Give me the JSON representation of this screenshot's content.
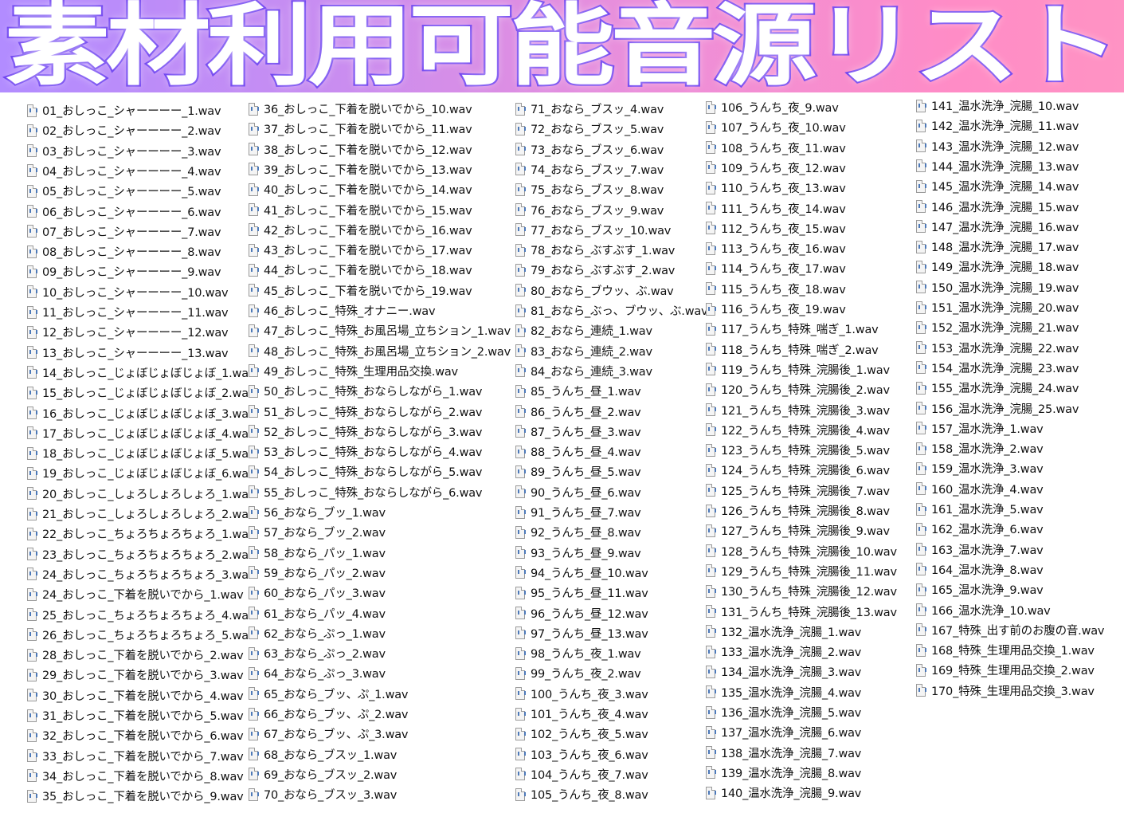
{
  "title": "素材利用可能音源リスト",
  "icon": "wav-file-icon",
  "columns": [
    [
      "01_おしっこ_シャーーーー_1.wav",
      "02_おしっこ_シャーーーー_2.wav",
      "03_おしっこ_シャーーーー_3.wav",
      "04_おしっこ_シャーーーー_4.wav",
      "05_おしっこ_シャーーーー_5.wav",
      "06_おしっこ_シャーーーー_6.wav",
      "07_おしっこ_シャーーーー_7.wav",
      "08_おしっこ_シャーーーー_8.wav",
      "09_おしっこ_シャーーーー_9.wav",
      "10_おしっこ_シャーーーー_10.wav",
      "11_おしっこ_シャーーーー_11.wav",
      "12_おしっこ_シャーーーー_12.wav",
      "13_おしっこ_シャーーーー_13.wav",
      "14_おしっこ_じょぼじょぼじょぼ_1.wav",
      "15_おしっこ_じょぼじょぼじょぼ_2.wav",
      "16_おしっこ_じょぼじょぼじょぼ_3.wav",
      "17_おしっこ_じょぼじょぼじょぼ_4.wav",
      "18_おしっこ_じょぼじょぼじょぼ_5.wav",
      "19_おしっこ_じょぼじょぼじょぼ_6.wav",
      "20_おしっこ_しょろしょろしょろ_1.wav",
      "21_おしっこ_しょろしょろしょろ_2.wav",
      "22_おしっこ_ちょろちょろちょろ_1.wav",
      "23_おしっこ_ちょろちょろちょろ_2.wav",
      "24_おしっこ_ちょろちょろちょろ_3.wav",
      "24_おしっこ_下着を脱いでから_1.wav",
      "25_おしっこ_ちょろちょろちょろ_4.wav",
      "26_おしっこ_ちょろちょろちょろ_5.wav",
      "28_おしっこ_下着を脱いでから_2.wav",
      "29_おしっこ_下着を脱いでから_3.wav",
      "30_おしっこ_下着を脱いでから_4.wav",
      "31_おしっこ_下着を脱いでから_5.wav",
      "32_おしっこ_下着を脱いでから_6.wav",
      "33_おしっこ_下着を脱いでから_7.wav",
      "34_おしっこ_下着を脱いでから_8.wav",
      "35_おしっこ_下着を脱いでから_9.wav"
    ],
    [
      "36_おしっこ_下着を脱いでから_10.wav",
      "37_おしっこ_下着を脱いでから_11.wav",
      "38_おしっこ_下着を脱いでから_12.wav",
      "39_おしっこ_下着を脱いでから_13.wav",
      "40_おしっこ_下着を脱いでから_14.wav",
      "41_おしっこ_下着を脱いでから_15.wav",
      "42_おしっこ_下着を脱いでから_16.wav",
      "43_おしっこ_下着を脱いでから_17.wav",
      "44_おしっこ_下着を脱いでから_18.wav",
      "45_おしっこ_下着を脱いでから_19.wav",
      "46_おしっこ_特殊_オナニー.wav",
      "47_おしっこ_特殊_お風呂場_立ちション_1.wav",
      "48_おしっこ_特殊_お風呂場_立ちション_2.wav",
      "49_おしっこ_特殊_生理用品交換.wav",
      "50_おしっこ_特殊_おならしながら_1.wav",
      "51_おしっこ_特殊_おならしながら_2.wav",
      "52_おしっこ_特殊_おならしながら_3.wav",
      "53_おしっこ_特殊_おならしながら_4.wav",
      "54_おしっこ_特殊_おならしながら_5.wav",
      "55_おしっこ_特殊_おならしながら_6.wav",
      "56_おなら_ブッ_1.wav",
      "57_おなら_ブッ_2.wav",
      "58_おなら_パッ_1.wav",
      "59_おなら_パッ_2.wav",
      "60_おなら_パッ_3.wav",
      "61_おなら_パッ_4.wav",
      "62_おなら_ぷっ_1.wav",
      "63_おなら_ぷっ_2.wav",
      "64_おなら_ぷっ_3.wav",
      "65_おなら_ブッ、ぷ_1.wav",
      "66_おなら_ブッ、ぷ_2.wav",
      "67_おなら_ブッ、ぷ_3.wav",
      "68_おなら_ブスッ_1.wav",
      "69_おなら_ブスッ_2.wav",
      "70_おなら_ブスッ_3.wav"
    ],
    [
      "71_おなら_ブスッ_4.wav",
      "72_おなら_ブスッ_5.wav",
      "73_おなら_ブスッ_6.wav",
      "74_おなら_ブスッ_7.wav",
      "75_おなら_ブスッ_8.wav",
      "76_おなら_ブスッ_9.wav",
      "77_おなら_ブスッ_10.wav",
      "78_おなら_ぶすぶす_1.wav",
      "79_おなら_ぶすぶす_2.wav",
      "80_おなら_ブウッ、ぶ.wav",
      "81_おなら_ぶっ、ブウッ、ぶ.wav",
      "82_おなら_連続_1.wav",
      "83_おなら_連続_2.wav",
      "84_おなら_連続_3.wav",
      "85_うんち_昼_1.wav",
      "86_うんち_昼_2.wav",
      "87_うんち_昼_3.wav",
      "88_うんち_昼_4.wav",
      "89_うんち_昼_5.wav",
      "90_うんち_昼_6.wav",
      "91_うんち_昼_7.wav",
      "92_うんち_昼_8.wav",
      "93_うんち_昼_9.wav",
      "94_うんち_昼_10.wav",
      "95_うんち_昼_11.wav",
      "96_うんち_昼_12.wav",
      "97_うんち_昼_13.wav",
      "98_うんち_夜_1.wav",
      "99_うんち_夜_2.wav",
      "100_うんち_夜_3.wav",
      "101_うんち_夜_4.wav",
      "102_うんち_夜_5.wav",
      "103_うんち_夜_6.wav",
      "104_うんち_夜_7.wav",
      "105_うんち_夜_8.wav"
    ],
    [
      "106_うんち_夜_9.wav",
      "107_うんち_夜_10.wav",
      "108_うんち_夜_11.wav",
      "109_うんち_夜_12.wav",
      "110_うんち_夜_13.wav",
      "111_うんち_夜_14.wav",
      "112_うんち_夜_15.wav",
      "113_うんち_夜_16.wav",
      "114_うんち_夜_17.wav",
      "115_うんち_夜_18.wav",
      "116_うんち_夜_19.wav",
      "117_うんち_特殊_喘ぎ_1.wav",
      "118_うんち_特殊_喘ぎ_2.wav",
      "119_うんち_特殊_浣腸後_1.wav",
      "120_うんち_特殊_浣腸後_2.wav",
      "121_うんち_特殊_浣腸後_3.wav",
      "122_うんち_特殊_浣腸後_4.wav",
      "123_うんち_特殊_浣腸後_5.wav",
      "124_うんち_特殊_浣腸後_6.wav",
      "125_うんち_特殊_浣腸後_7.wav",
      "126_うんち_特殊_浣腸後_8.wav",
      "127_うんち_特殊_浣腸後_9.wav",
      "128_うんち_特殊_浣腸後_10.wav",
      "129_うんち_特殊_浣腸後_11.wav",
      "130_うんち_特殊_浣腸後_12.wav",
      "131_うんち_特殊_浣腸後_13.wav",
      "132_温水洗浄_浣腸_1.wav",
      "133_温水洗浄_浣腸_2.wav",
      "134_温水洗浄_浣腸_3.wav",
      "135_温水洗浄_浣腸_4.wav",
      "136_温水洗浄_浣腸_5.wav",
      "137_温水洗浄_浣腸_6.wav",
      "138_温水洗浄_浣腸_7.wav",
      "139_温水洗浄_浣腸_8.wav",
      "140_温水洗浄_浣腸_9.wav"
    ],
    [
      "141_温水洗浄_浣腸_10.wav",
      "142_温水洗浄_浣腸_11.wav",
      "143_温水洗浄_浣腸_12.wav",
      "144_温水洗浄_浣腸_13.wav",
      "145_温水洗浄_浣腸_14.wav",
      "146_温水洗浄_浣腸_15.wav",
      "147_温水洗浄_浣腸_16.wav",
      "148_温水洗浄_浣腸_17.wav",
      "149_温水洗浄_浣腸_18.wav",
      "150_温水洗浄_浣腸_19.wav",
      "151_温水洗浄_浣腸_20.wav",
      "152_温水洗浄_浣腸_21.wav",
      "153_温水洗浄_浣腸_22.wav",
      "154_温水洗浄_浣腸_23.wav",
      "155_温水洗浄_浣腸_24.wav",
      "156_温水洗浄_浣腸_25.wav",
      "157_温水洗浄_1.wav",
      "158_温水洗浄_2.wav",
      "159_温水洗浄_3.wav",
      "160_温水洗浄_4.wav",
      "161_温水洗浄_5.wav",
      "162_温水洗浄_6.wav",
      "163_温水洗浄_7.wav",
      "164_温水洗浄_8.wav",
      "165_温水洗浄_9.wav",
      "166_温水洗浄_10.wav",
      "167_特殊_出す前のお腹の音.wav",
      "168_特殊_生理用品交換_1.wav",
      "169_特殊_生理用品交換_2.wav",
      "170_特殊_生理用品交換_3.wav"
    ]
  ]
}
